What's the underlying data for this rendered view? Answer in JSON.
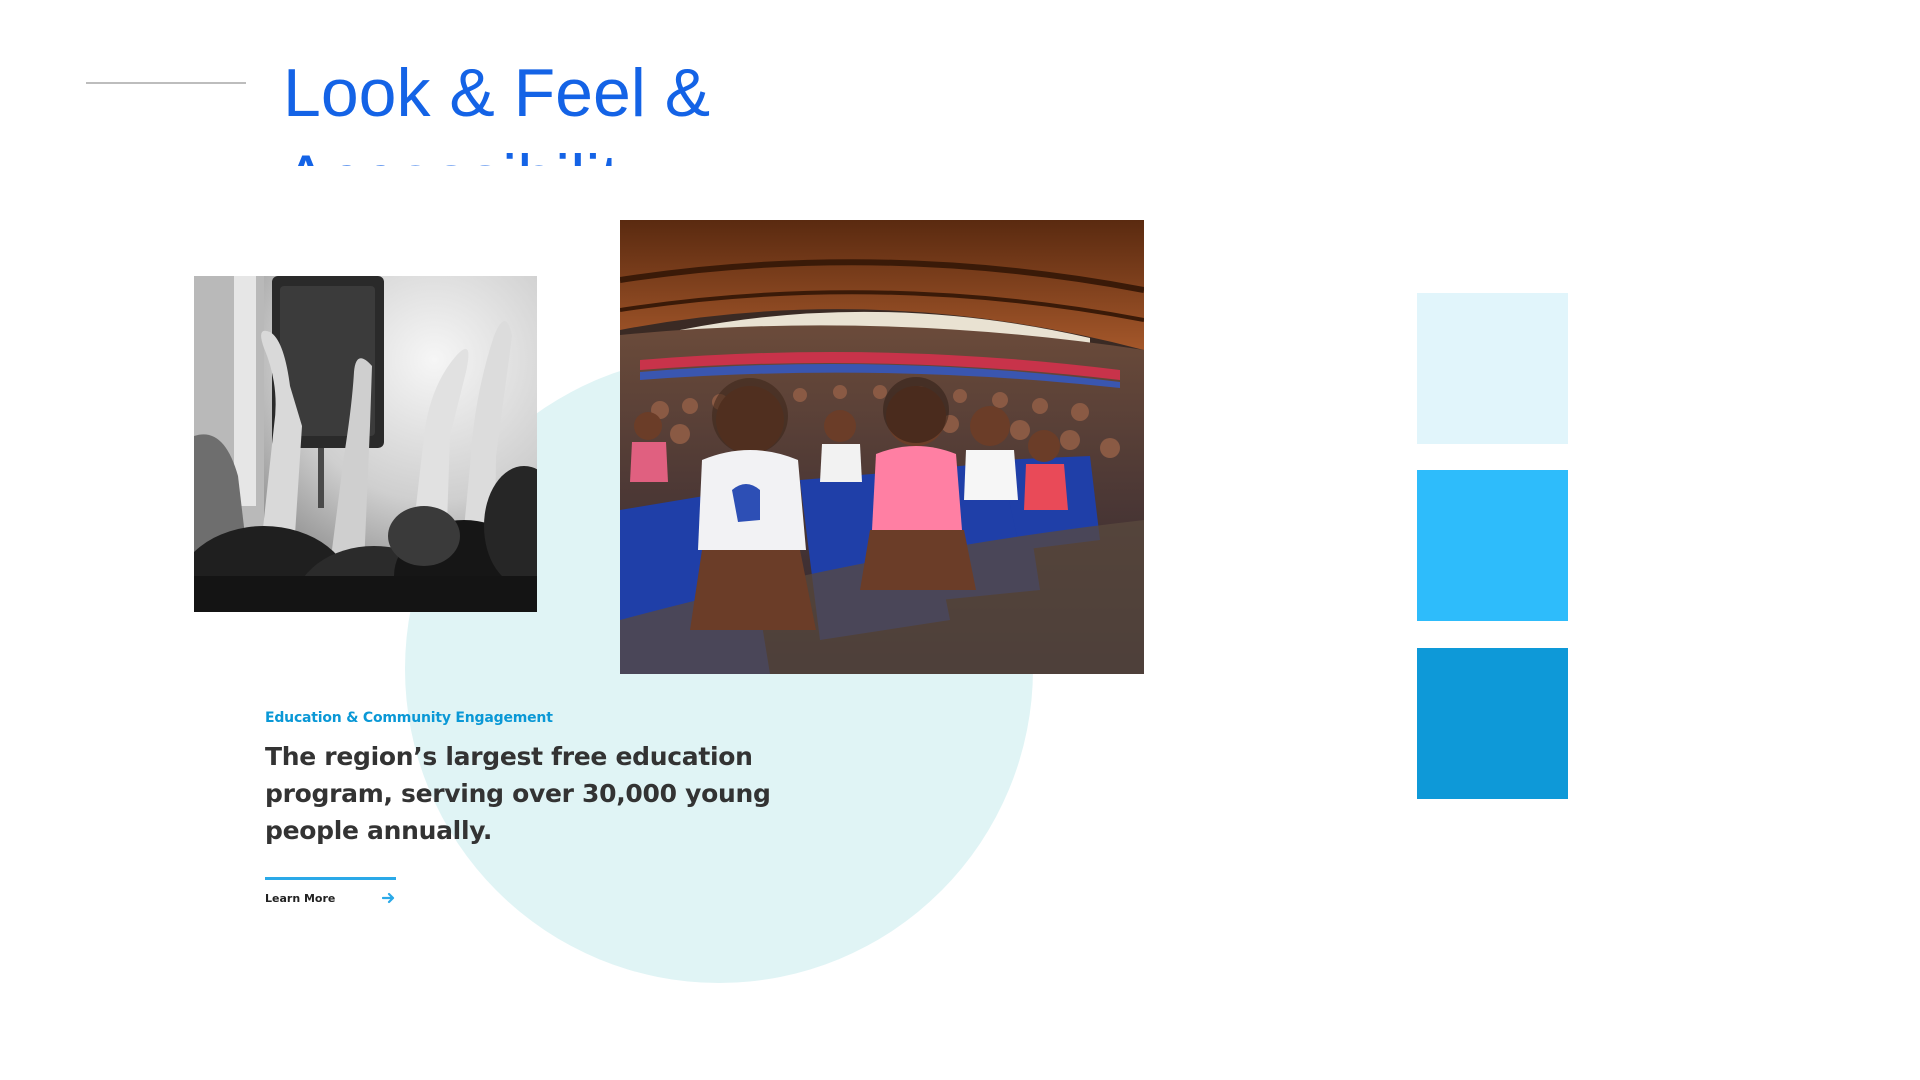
{
  "slide": {
    "title": "Look & Feel &\nAccessibility"
  },
  "feature": {
    "eyebrow": "Education & Community Engagement",
    "headline": "The region’s largest free education program, serving over 30,000 young people annually.",
    "cta_label": "Learn More",
    "cta_icon": "arrow-right-icon"
  },
  "photos": {
    "left": "raised-hands-photo",
    "right": "children-in-pavilion-photo"
  },
  "palette": [
    {
      "name": "light-cyan-swatch",
      "color": "#e1f5fb"
    },
    {
      "name": "sky-blue-swatch",
      "color": "#2ebcfb"
    },
    {
      "name": "deep-blue-swatch",
      "color": "#0e99d8"
    }
  ],
  "colors": {
    "title": "#1463e6",
    "eyebrow": "#0a98d6",
    "headline": "#333333",
    "circle": "#e0f4f5",
    "accent_line": "#2aa9e8"
  }
}
